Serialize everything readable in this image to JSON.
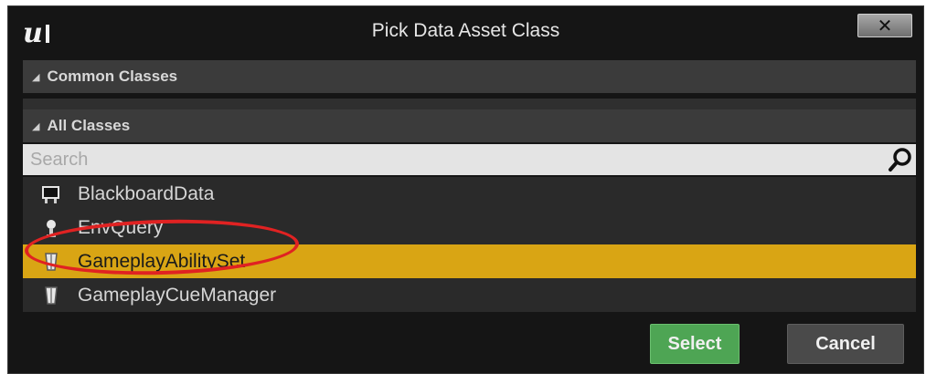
{
  "window": {
    "title": "Pick Data Asset Class",
    "close_label": "✕"
  },
  "sections": {
    "common": {
      "label": "Common Classes"
    },
    "all": {
      "label": "All Classes"
    }
  },
  "search": {
    "placeholder": "Search",
    "value": ""
  },
  "classes": [
    {
      "label": "BlackboardData",
      "icon": "blackboard-data-icon",
      "selected": false
    },
    {
      "label": "EnvQuery",
      "icon": "env-query-icon",
      "selected": false
    },
    {
      "label": "GameplayAbilitySet",
      "icon": "data-asset-icon",
      "selected": true
    },
    {
      "label": "GameplayCueManager",
      "icon": "data-asset-icon",
      "selected": false
    }
  ],
  "buttons": {
    "select": "Select",
    "cancel": "Cancel"
  },
  "colors": {
    "selection": "#d9a514",
    "select_button": "#4ea554",
    "annotation": "#e02222"
  }
}
